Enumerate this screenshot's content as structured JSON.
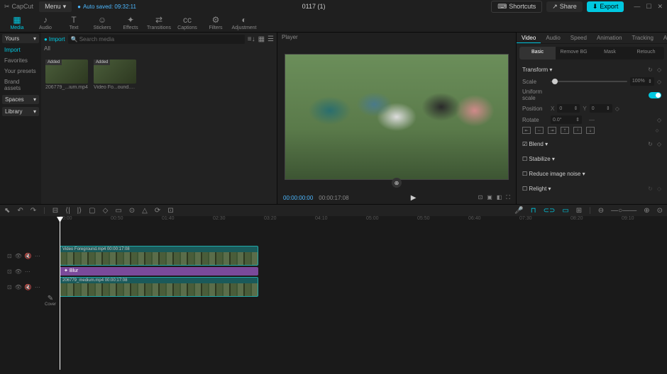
{
  "titlebar": {
    "app": "CapCut",
    "menu": "Menu",
    "autosave": "Auto saved: 09:32:11",
    "project": "0117 (1)",
    "shortcuts": "Shortcuts",
    "share": "Share",
    "export": "Export"
  },
  "toolbar": [
    {
      "icon": "▦",
      "label": "Media"
    },
    {
      "icon": "♪",
      "label": "Audio"
    },
    {
      "icon": "T",
      "label": "Text"
    },
    {
      "icon": "☺",
      "label": "Stickers"
    },
    {
      "icon": "✦",
      "label": "Effects"
    },
    {
      "icon": "⇄",
      "label": "Transitions"
    },
    {
      "icon": "cc",
      "label": "Captions"
    },
    {
      "icon": "⚙",
      "label": "Filters"
    },
    {
      "icon": "◐",
      "label": "Adjustment"
    }
  ],
  "media": {
    "yours": "Yours",
    "sidebar": [
      "Import",
      "Favorites",
      "Your presets",
      "Brand assets"
    ],
    "dropdowns": [
      "Spaces",
      "Library"
    ],
    "import_btn": "Import",
    "search_placeholder": "Search media",
    "tab_all": "All",
    "clips": [
      {
        "badge": "Added",
        "name": "206779_...ium.mp4"
      },
      {
        "badge": "Added",
        "name": "Video Fo...ound.mp4"
      }
    ]
  },
  "player": {
    "title": "Player",
    "time_current": "00:00:00:00",
    "time_total": "00:00:17:08"
  },
  "props": {
    "tabs": [
      "Video",
      "Audio",
      "Speed",
      "Animation",
      "Tracking",
      "Adjustment"
    ],
    "subtabs": [
      "Basic",
      "Remove BG",
      "Mask",
      "Retouch"
    ],
    "transform": "Transform",
    "scale": "Scale",
    "scale_val": "100%",
    "uniform": "Uniform scale",
    "position": "Position",
    "pos_x_lbl": "X",
    "pos_x": "0",
    "pos_y_lbl": "Y",
    "pos_y": "0",
    "rotate": "Rotate",
    "rotate_val": "0.0°",
    "blend": "Blend",
    "stabilize": "Stabilize",
    "denoise": "Reduce image noise",
    "relight": "Relight"
  },
  "timeline": {
    "ticks": [
      "00:00",
      "00:50",
      "01:40",
      "02:30",
      "03:20",
      "04:10",
      "05:00",
      "05:50",
      "06:40",
      "07:30",
      "08:20",
      "09:10"
    ],
    "track1": "Video Foreground.mp4  00:00:17:08",
    "fx": "Blur",
    "track2": "206779_medium.mp4  00:00:17:08",
    "cover": "Cover"
  }
}
